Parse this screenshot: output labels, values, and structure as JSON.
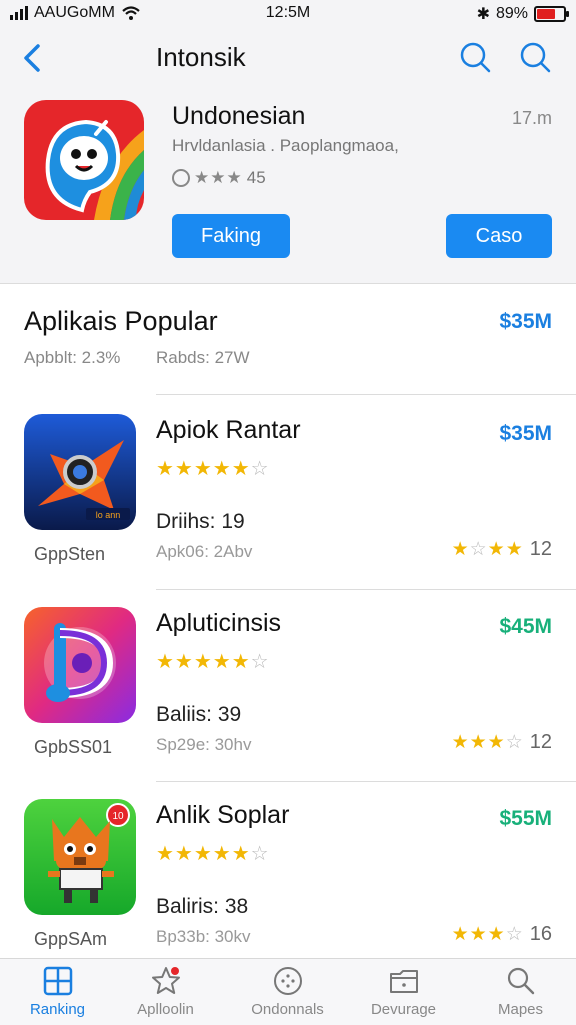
{
  "status": {
    "carrier": "AAUGoMM",
    "time": "12:5M",
    "battery": "89%"
  },
  "nav": {
    "title": "Intonsik"
  },
  "featured": {
    "name": "Undonesian",
    "size": "17.m",
    "subtitle": "Hrvldanlasia . Paoplangmaoa,",
    "rating": "45",
    "button_left": "Faking",
    "button_right": "Caso"
  },
  "section": {
    "title": "Aplikais Popular",
    "price": "$35M",
    "stat1": "Apbblt: 2.3%",
    "stat2": "Rabds: 27W"
  },
  "apps": [
    {
      "name": "Apiok Rantar",
      "price": "$35M",
      "price_color": "#1a7fe0",
      "meta1": "Driihs: 19",
      "meta2": "Apk06: 2Abv",
      "caption": "GppSten",
      "rating": "12",
      "stars": 4.5
    },
    {
      "name": "Apluticinsis",
      "price": "$45M",
      "price_color": "#18b07a",
      "meta1": "Baliis: 39",
      "meta2": "Sp29e: 30hv",
      "caption": "GpbSS01",
      "rating": "12",
      "stars": 4.5
    },
    {
      "name": "Anlik Soplar",
      "price": "$55M",
      "price_color": "#18b07a",
      "meta1": "Baliris: 38",
      "meta2": "Bp33b: 30kv",
      "caption": "GppSAm",
      "rating": "16",
      "stars": 4.5
    }
  ],
  "tabs": [
    {
      "label": "Ranking",
      "icon": "grid-icon",
      "active": true
    },
    {
      "label": "Aplloolin",
      "icon": "star-icon"
    },
    {
      "label": "Ondonnals",
      "icon": "compass-icon"
    },
    {
      "label": "Devurage",
      "icon": "folder-icon"
    },
    {
      "label": "Mapes",
      "icon": "search-icon"
    }
  ]
}
